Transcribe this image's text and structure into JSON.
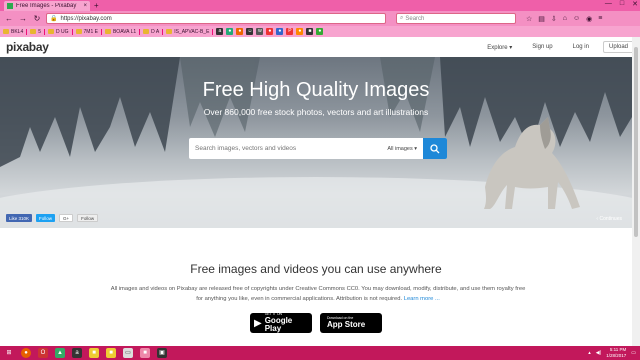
{
  "browser": {
    "tab_title": "Free Images - Pixabay",
    "tab_close": "×",
    "new_tab": "+",
    "url": "https://pixabay.com",
    "search_placeholder": "Search",
    "window_controls": [
      "—",
      "□",
      "✕"
    ]
  },
  "bookmarks": [
    "BKL4",
    "5",
    "D UG",
    "7M1 E",
    "BOAVA L1",
    "D A",
    "IS_APVAC-B_E"
  ],
  "site": {
    "logo": "pixabay",
    "nav": {
      "explore": "Explore ▾",
      "signup": "Sign up",
      "login": "Log in",
      "upload": "Upload"
    }
  },
  "hero": {
    "title": "Free High Quality Images",
    "subtitle": "Over 860,000 free stock photos, vectors and art illustrations",
    "search_placeholder": "Search images, vectors and videos",
    "search_type": "All images ▾",
    "continue": "‹  Continues"
  },
  "social": {
    "facebook": "Like 310K",
    "twitter": "Follow",
    "gplus": "G+",
    "gfollow": "Follow"
  },
  "content": {
    "title": "Free images and videos you can use anywhere",
    "body": "All images and videos on Pixabay are released free of copyrights under Creative Commons CC0. You may download, modify, distribute, and use them royalty free for anything you like, even in commercial applications. Attribution is not required.",
    "learn_more": "Learn more ..."
  },
  "stores": {
    "google_small": "GET IT ON",
    "google_big": "Google Play",
    "apple_small": "Download on the",
    "apple_big": "App Store"
  },
  "taskbar": {
    "time": "5:11 PM",
    "date": "1/28/2017"
  },
  "colors": {
    "accent": "#1e88d8",
    "browser_chrome": "#f06cb0",
    "taskbar": "#c2185b"
  }
}
